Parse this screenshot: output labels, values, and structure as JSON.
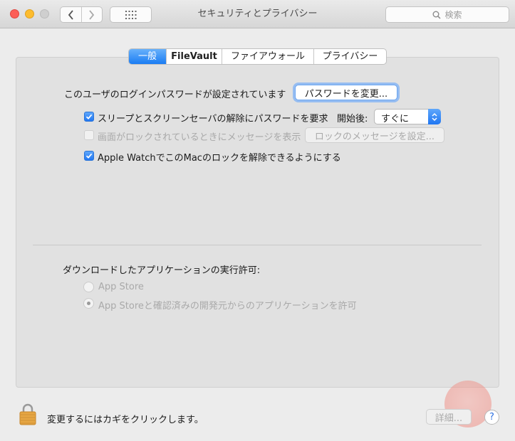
{
  "window": {
    "title": "セキュリティとプライバシー",
    "search_placeholder": "検索"
  },
  "tabs": [
    {
      "label": "一般",
      "active": true
    },
    {
      "label": "FileVault",
      "active": false
    },
    {
      "label": "ファイアウォール",
      "active": false
    },
    {
      "label": "プライバシー",
      "active": false
    }
  ],
  "general": {
    "password_status": "このユーザのログインパスワードが設定されています",
    "change_password_button": "パスワードを変更...",
    "require_password": {
      "label": "スリープとスクリーンセーバの解除にパスワードを要求",
      "checked": true,
      "delay_label": "開始後:",
      "delay_value": "すぐに"
    },
    "lock_message": {
      "label": "画面がロックされているときにメッセージを表示",
      "checked": false,
      "enabled": false,
      "button": "ロックのメッセージを設定..."
    },
    "apple_watch": {
      "label": "Apple WatchでこのMacのロックを解除できるようにする",
      "checked": true
    },
    "downloads": {
      "heading": "ダウンロードしたアプリケーションの実行許可:",
      "options": [
        {
          "label": "App Store",
          "selected": false
        },
        {
          "label": "App Storeと確認済みの開発元からのアプリケーションを許可",
          "selected": true
        }
      ]
    }
  },
  "footer": {
    "lock_text": "変更するにはカギをクリックします。",
    "advanced_button": "詳細...",
    "help_label": "?"
  },
  "colors": {
    "accent": "#1a7cf3",
    "close": "#fc5f57",
    "minimize": "#fdbc2e",
    "lock": "#e6a643"
  }
}
